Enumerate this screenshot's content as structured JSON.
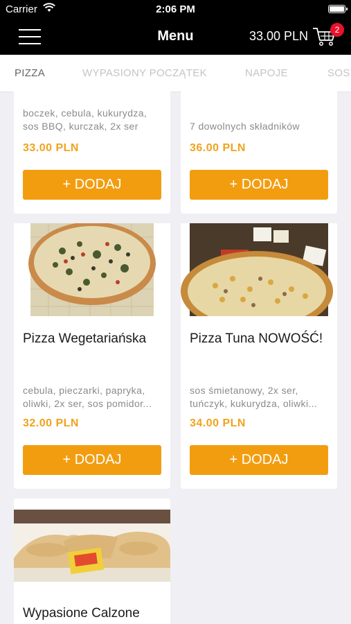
{
  "status_bar": {
    "carrier": "Carrier",
    "time": "2:06 PM"
  },
  "navbar": {
    "title": "Menu",
    "cart_total": "33.00 PLN",
    "cart_count": "2"
  },
  "tabs": [
    {
      "label": "PIZZA",
      "active": true
    },
    {
      "label": "WYPASIONY POCZĄTEK",
      "active": false
    },
    {
      "label": "NAPOJE",
      "active": false
    },
    {
      "label": "SOSY",
      "active": false
    }
  ],
  "products": [
    {
      "title": "",
      "description": "boczek, cebula, kukurydza, sos BBQ, kurczak, 2x ser",
      "price": "33.00 PLN",
      "button": "+ DODAJ"
    },
    {
      "title": "",
      "description": "7 dowolnych składników",
      "price": "36.00 PLN",
      "button": "+ DODAJ"
    },
    {
      "title": "Pizza Wegetariańska",
      "description": "cebula, pieczarki, papryka, oliwki, 2x ser, sos pomidor...",
      "price": "32.00 PLN",
      "button": "+ DODAJ"
    },
    {
      "title": "Pizza Tuna  NOWOŚĆ!",
      "description": "sos śmietanowy, 2x ser, tuńczyk, kukurydza, oliwki...",
      "price": "34.00 PLN",
      "button": "+ DODAJ"
    },
    {
      "title": "Wypasione Calzone",
      "description": "",
      "price": "",
      "button": ""
    }
  ],
  "colors": {
    "accent": "#f29d10",
    "price": "#f0a31c",
    "badge": "#e8132b"
  }
}
